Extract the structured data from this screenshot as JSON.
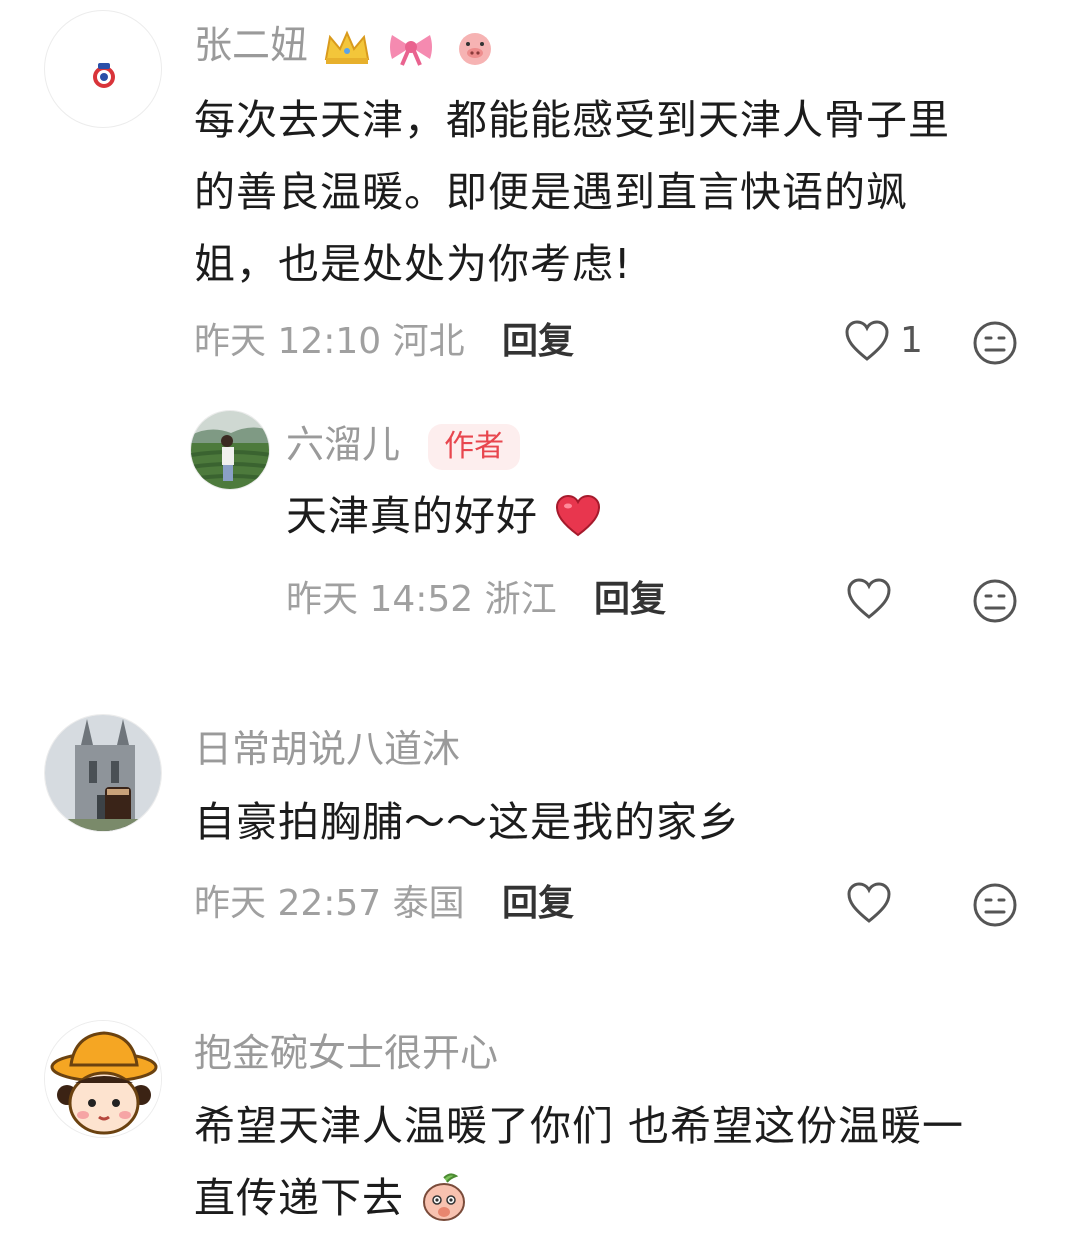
{
  "comments": [
    {
      "username": "张二妞",
      "text_lines": [
        "每次去天津，都能能感受到天津人骨子里",
        "的善良温暖。即便是遇到直言快语的飒",
        "姐，也是处处为你考虑!"
      ],
      "time": "昨天 12:10",
      "location": "河北",
      "reply_label": "回复",
      "likes": "1",
      "username_icons": [
        "crown-icon",
        "bow-icon",
        "pig-icon"
      ]
    },
    {
      "username": "六溜儿",
      "badge": "作者",
      "text": "天津真的好好",
      "text_icon": "heart-emoji",
      "time": "昨天 14:52",
      "location": "浙江",
      "reply_label": "回复"
    },
    {
      "username": "日常胡说八道沐",
      "text": "自豪拍胸脯～～这是我的家乡",
      "time": "昨天 22:57",
      "location": "泰国",
      "reply_label": "回复"
    },
    {
      "username": "抱金碗女士很开心",
      "text_lines": [
        "希望天津人温暖了你们 也希望这份温暖一",
        "直传递下去"
      ],
      "text_icon": "peach-emoji",
      "time": "",
      "location": "",
      "reply_label": ""
    }
  ],
  "colors": {
    "username": "#9a9a9a",
    "meta": "#a0a0a0",
    "badge_bg": "#fdeeee",
    "badge_text": "#e8464e",
    "heart_emoji": "#e8364e"
  }
}
